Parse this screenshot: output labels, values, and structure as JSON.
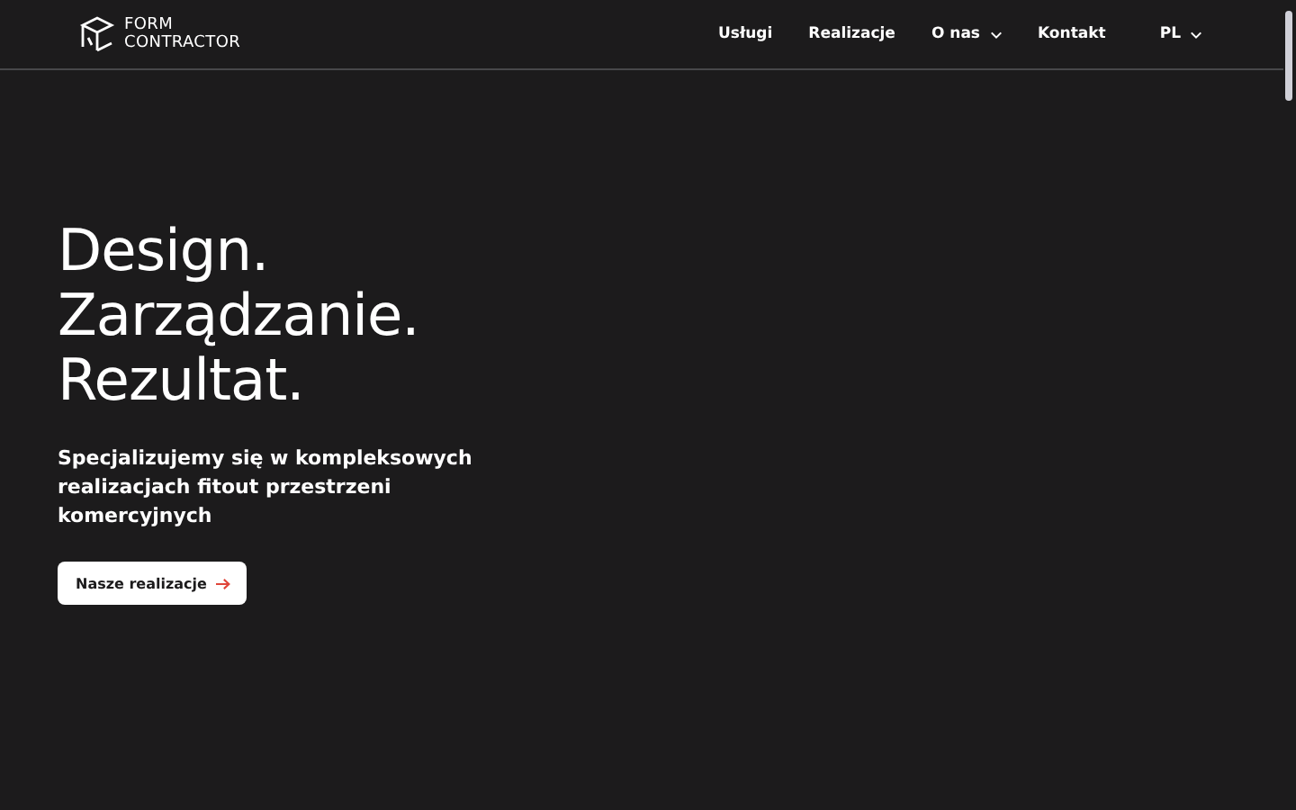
{
  "logo": {
    "line_1": "FORM",
    "line_2": "CONTRACTOR"
  },
  "nav": [
    {
      "label": "Usługi",
      "dropdown": false
    },
    {
      "label": "Realizacje",
      "dropdown": false
    },
    {
      "label": "O nas",
      "dropdown": true
    },
    {
      "label": "Kontakt",
      "dropdown": false
    }
  ],
  "language": {
    "label": "PL"
  },
  "hero": {
    "heading": [
      "Design.",
      "Zarządzanie.",
      "Rezultat."
    ],
    "subtitle": "Specjalizujemy się w kompleksowych realizacjach fitout przestrzeni komercyjnych",
    "button": "Nasze realizacje"
  }
}
